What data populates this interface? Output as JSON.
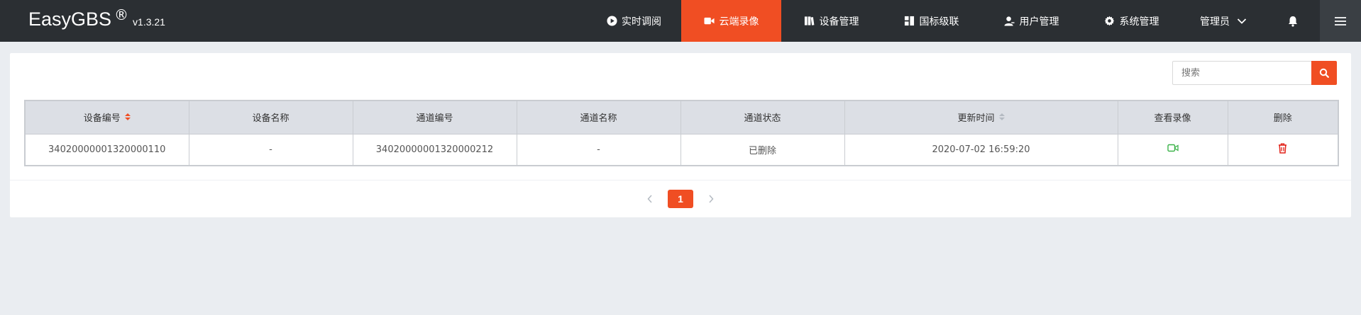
{
  "brand": {
    "name": "EasyGBS",
    "reg": "®",
    "version": "v1.3.21"
  },
  "nav": [
    {
      "label": "实时调阅",
      "icon": "play-circle-icon",
      "active": false
    },
    {
      "label": "云端录像",
      "icon": "video-camera-icon",
      "active": true
    },
    {
      "label": "设备管理",
      "icon": "book-icon",
      "active": false
    },
    {
      "label": "国标级联",
      "icon": "cascade-icon",
      "active": false
    },
    {
      "label": "用户管理",
      "icon": "user-icon",
      "active": false
    },
    {
      "label": "系统管理",
      "icon": "gear-icon",
      "active": false
    }
  ],
  "user": {
    "label": "管理员"
  },
  "search": {
    "placeholder": "搜索"
  },
  "table": {
    "headers": [
      "设备编号",
      "设备名称",
      "通道编号",
      "通道名称",
      "通道状态",
      "更新时间",
      "查看录像",
      "删除"
    ],
    "rows": [
      {
        "device_id": "34020000001320000110",
        "device_name": "-",
        "channel_id": "34020000001320000212",
        "channel_name": "-",
        "channel_status": "已删除",
        "updated_at": "2020-07-02 16:59:20"
      }
    ]
  },
  "pagination": {
    "current_page": "1"
  },
  "colors": {
    "accent": "#f04e23",
    "topbar": "#2b2f33",
    "view_icon": "#3cb34a",
    "delete_icon": "#e2231a"
  }
}
